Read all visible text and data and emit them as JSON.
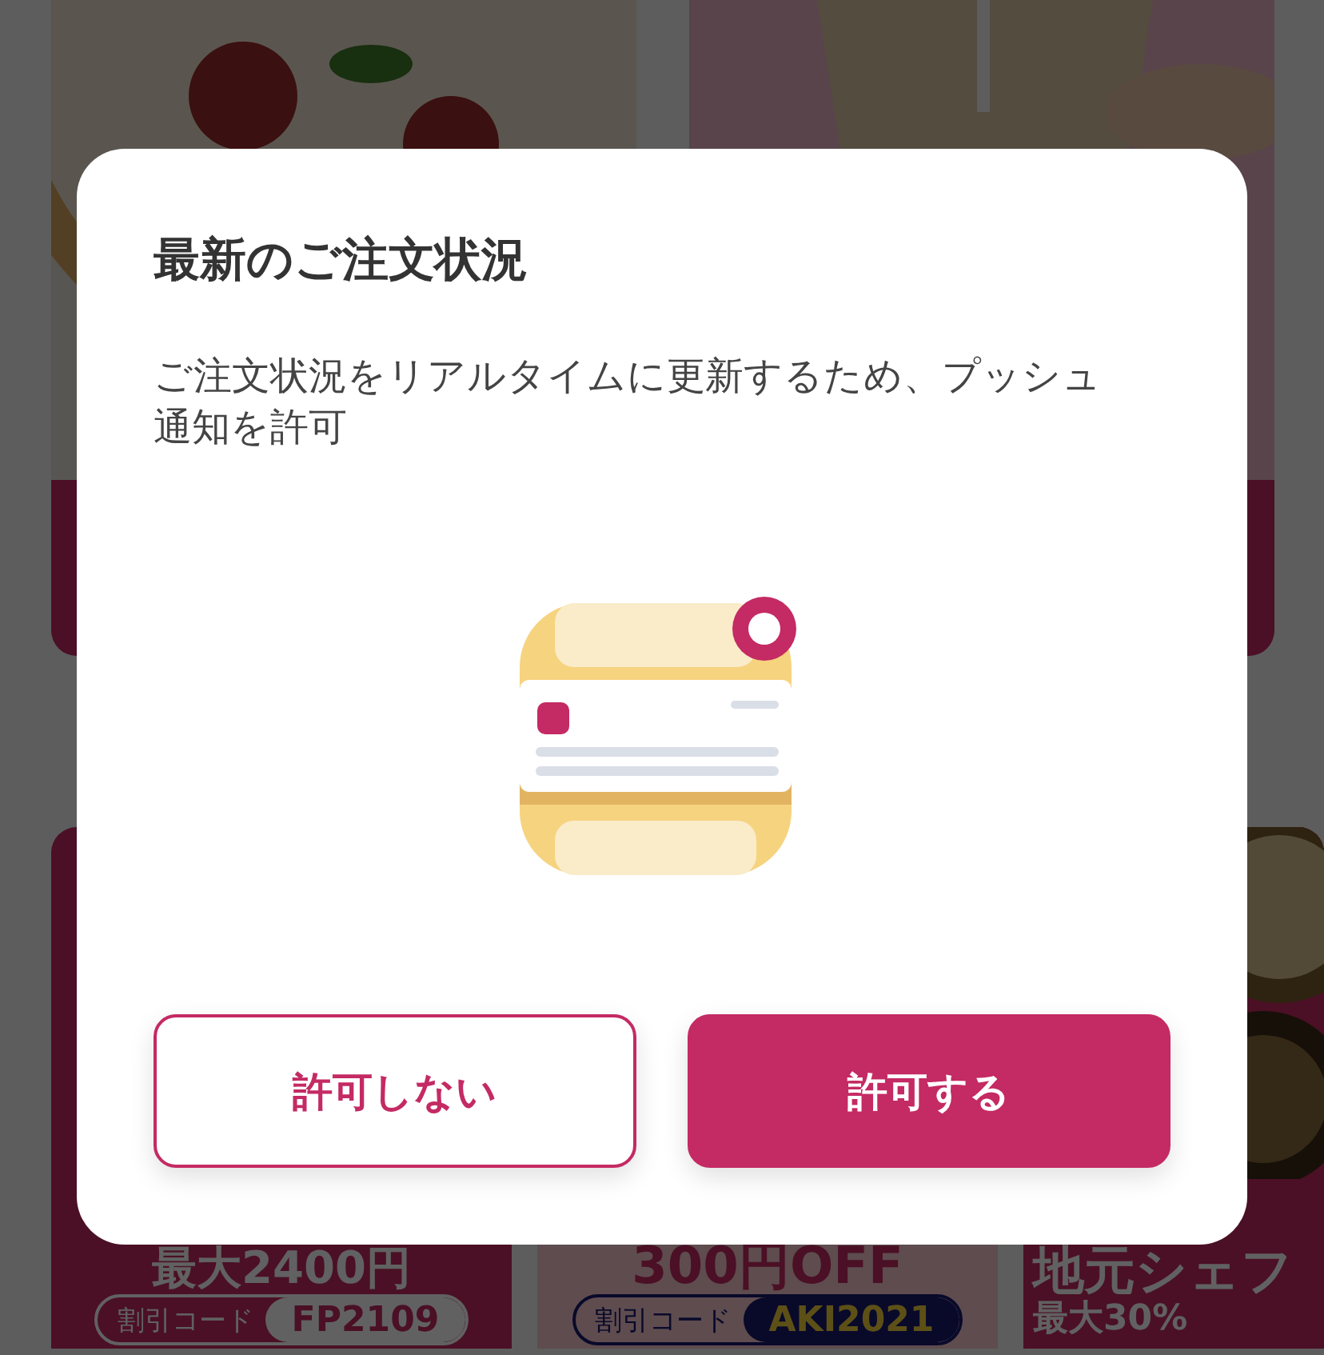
{
  "background": {
    "promos": [
      {
        "kind": "discount",
        "headline": "最大2400円",
        "code_label": "割引コード",
        "code": "FP2109"
      },
      {
        "kind": "off",
        "headline": "300円OFF",
        "code_label": "割引コード",
        "code": "AKI2021"
      },
      {
        "kind": "chef",
        "headline": "地元シェフ",
        "subline": "最大30%"
      }
    ]
  },
  "dialog": {
    "title": "最新のご注文状況",
    "message": "ご注文状況をリアルタイムに更新するため、プッシュ通知を許可",
    "buttons": [
      {
        "label": "許可しない",
        "kind": "secondary"
      },
      {
        "label": "許可する",
        "kind": "primary"
      }
    ]
  }
}
